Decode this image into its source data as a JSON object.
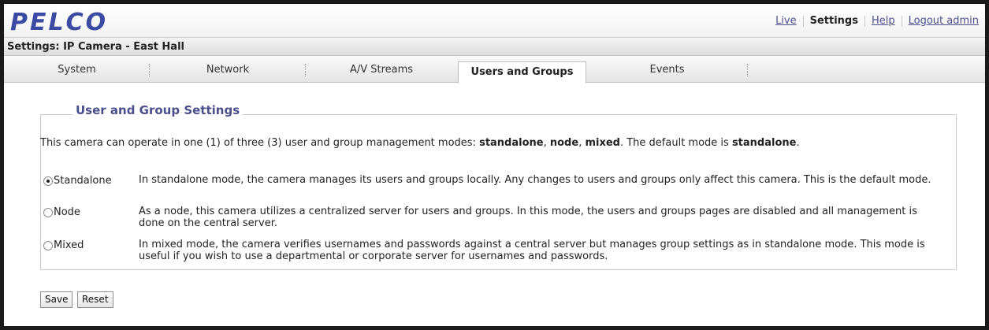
{
  "brand": {
    "logo_text": "PELCO"
  },
  "top_nav": {
    "links": [
      {
        "label": "Live",
        "active": false
      },
      {
        "label": "Settings",
        "active": true
      },
      {
        "label": "Help",
        "active": false
      },
      {
        "label": "Logout admin",
        "active": false
      }
    ]
  },
  "page_title": "Settings: IP Camera - East Hall",
  "tabs": [
    {
      "label": "System",
      "active": false
    },
    {
      "label": "Network",
      "active": false
    },
    {
      "label": "A/V Streams",
      "active": false
    },
    {
      "label": "Users and Groups",
      "active": true
    },
    {
      "label": "Events",
      "active": false
    }
  ],
  "section": {
    "legend": "User and Group Settings",
    "intro_prefix": "This camera can operate in one (1) of three (3) user and group management modes: ",
    "intro_mode1": "standalone",
    "intro_comma1": ", ",
    "intro_mode2": "node",
    "intro_comma2": ", ",
    "intro_mode3": "mixed",
    "intro_mid": ". The default mode is ",
    "intro_default": "standalone",
    "intro_end": ".",
    "modes": [
      {
        "label": "Standalone",
        "selected": true,
        "description": "In standalone mode, the camera manages its users and groups locally. Any changes to users and groups only affect this camera. This is the default mode."
      },
      {
        "label": "Node",
        "selected": false,
        "description": "As a node, this camera utilizes a centralized server for users and groups. In this mode, the users and groups pages are disabled and all management is done on the central server."
      },
      {
        "label": "Mixed",
        "selected": false,
        "description": "In mixed mode, the camera verifies usernames and passwords against a central server but manages group settings as in standalone mode. This mode is useful if you wish to use a departmental or corporate server for usernames and passwords."
      }
    ]
  },
  "buttons": {
    "save": "Save",
    "reset": "Reset"
  },
  "colors": {
    "accent": "#4a4f8c",
    "logo": "#3b4aa3"
  }
}
